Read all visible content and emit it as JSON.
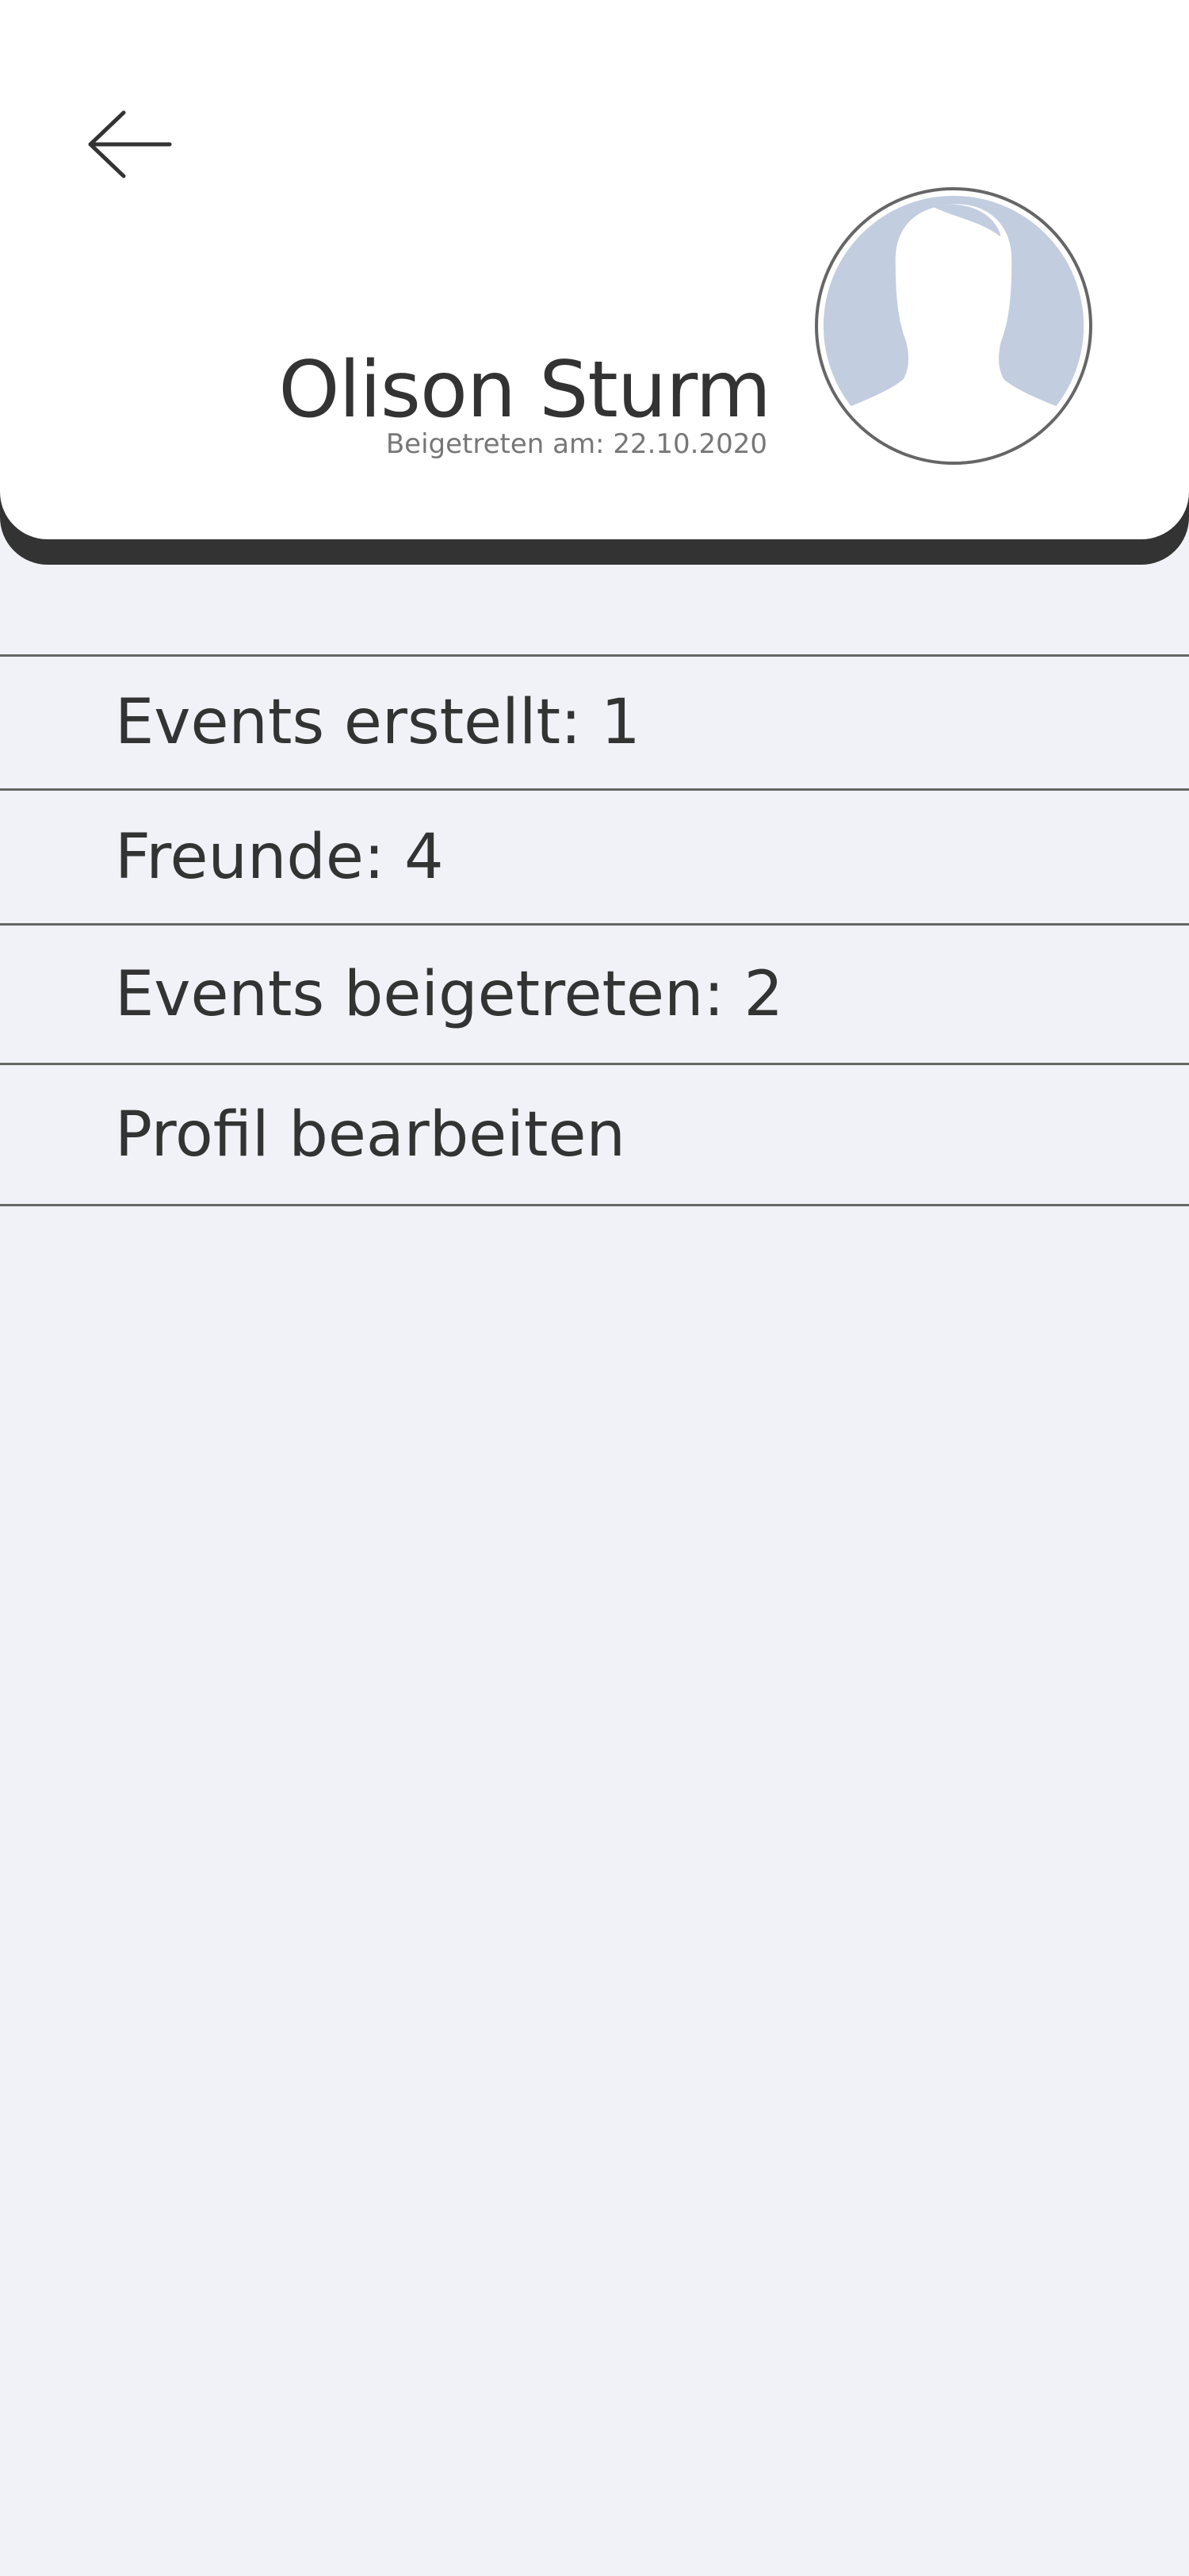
{
  "header": {
    "back_icon": "arrow-left-icon",
    "name": "Olison Sturm",
    "joined": "Beigetreten am: 22.10.2020",
    "avatar_icon": "person-silhouette-icon",
    "colors": {
      "card": "#ffffff",
      "shadow": "#333333",
      "avatar_fill": "#c3cde0"
    }
  },
  "stats": [
    {
      "label": "Events erstellt: 1"
    },
    {
      "label": "Freunde: 4"
    },
    {
      "label": "Events beigetreten: 2"
    }
  ],
  "actions": {
    "edit_profile": "Profil bearbeiten"
  },
  "colors": {
    "background": "#f1f2f7",
    "text": "#333333",
    "divider": "#666666",
    "muted_text": "#777777"
  }
}
